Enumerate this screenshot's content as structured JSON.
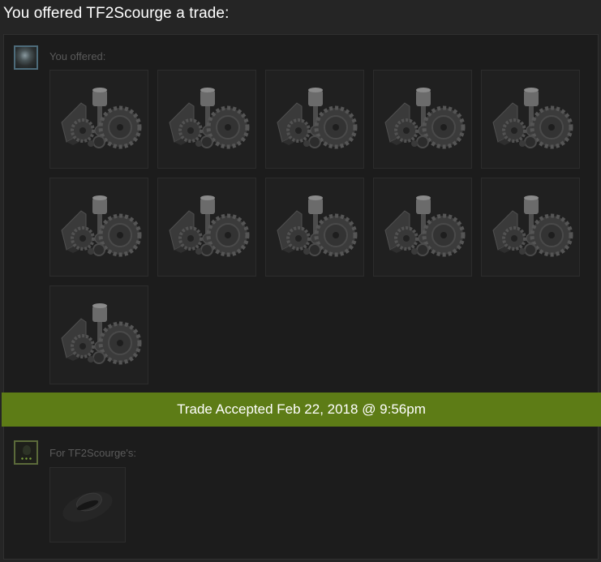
{
  "header": {
    "title": "You offered TF2Scourge a trade:"
  },
  "offer": {
    "you_label": "You offered:",
    "items": [
      {
        "icon": "metal-parts-icon"
      },
      {
        "icon": "metal-parts-icon"
      },
      {
        "icon": "metal-parts-icon"
      },
      {
        "icon": "metal-parts-icon"
      },
      {
        "icon": "metal-parts-icon"
      },
      {
        "icon": "metal-parts-icon"
      },
      {
        "icon": "metal-parts-icon"
      },
      {
        "icon": "metal-parts-icon"
      },
      {
        "icon": "metal-parts-icon"
      },
      {
        "icon": "metal-parts-icon"
      },
      {
        "icon": "metal-parts-icon"
      }
    ]
  },
  "status": {
    "text": "Trade Accepted Feb 22, 2018 @ 9:56pm",
    "color": "#5d7c16"
  },
  "receive": {
    "them_label": "For TF2Scourge's:",
    "items": [
      {
        "icon": "hat-icon"
      }
    ]
  }
}
